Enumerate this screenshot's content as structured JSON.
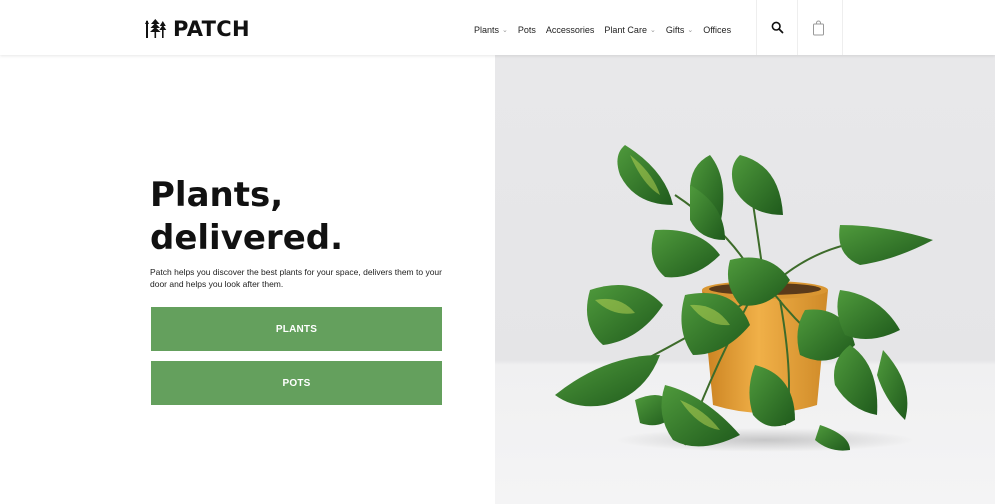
{
  "brand": {
    "name": "PATCH"
  },
  "nav": {
    "items": [
      {
        "label": "Plants",
        "has_dropdown": true
      },
      {
        "label": "Pots",
        "has_dropdown": false
      },
      {
        "label": "Accessories",
        "has_dropdown": false
      },
      {
        "label": "Plant Care",
        "has_dropdown": true
      },
      {
        "label": "Gifts",
        "has_dropdown": true
      },
      {
        "label": "Offices",
        "has_dropdown": false
      }
    ],
    "icons": [
      "search-icon",
      "shopping-bag-icon"
    ]
  },
  "hero": {
    "title_line1": "Plants,",
    "title_line2": "delivered.",
    "description": "Patch helps you discover the best plants for your space, delivers them to your door and helps you look after them.",
    "buttons": {
      "plants": "PLANTS",
      "pots": "POTS"
    },
    "image_subject": "potted-pothos-plant"
  },
  "colors": {
    "accent": "#64a05d",
    "pot": "#e7a23a",
    "leaf": "#2f6f28",
    "background": "#ffffff",
    "image_background": "#e8e8ea"
  }
}
